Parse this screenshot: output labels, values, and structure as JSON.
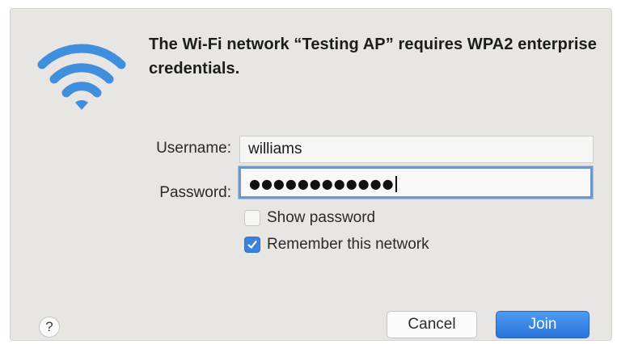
{
  "dialog": {
    "title": "The Wi-Fi network “Testing AP” requires WPA2 enterprise credentials.",
    "icon": "wifi-icon",
    "accent_color": "#3b82e0"
  },
  "form": {
    "username_label": "Username:",
    "username_value": "williams",
    "password_label": "Password:",
    "password_masked": "●●●●●●●●●●●●"
  },
  "options": {
    "show_password_label": "Show password",
    "show_password_checked": false,
    "remember_label": "Remember this network",
    "remember_checked": true
  },
  "buttons": {
    "help_label": "?",
    "cancel_label": "Cancel",
    "join_label": "Join"
  }
}
